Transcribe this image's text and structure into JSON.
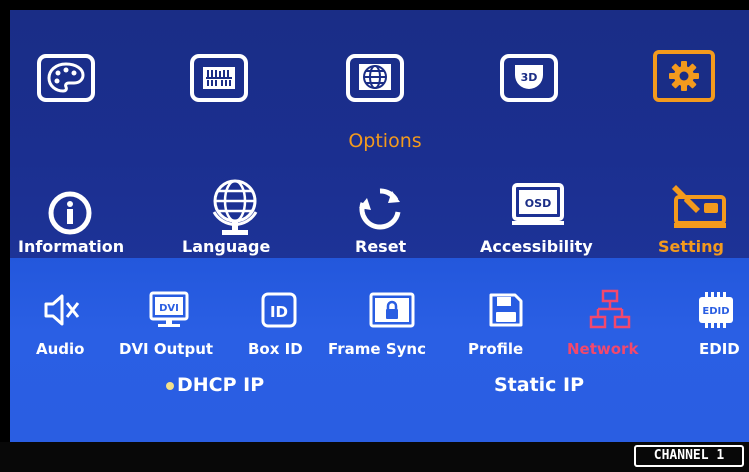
{
  "top_menu": {
    "items": [
      {
        "icon": "palette-icon",
        "selected": false
      },
      {
        "icon": "sliders-icon",
        "selected": false
      },
      {
        "icon": "globe-icon",
        "selected": false
      },
      {
        "icon": "3d-icon",
        "selected": false
      },
      {
        "icon": "gear-icon",
        "selected": true
      }
    ],
    "selected_label": "Options",
    "accent_color": "#f39a1d"
  },
  "options_row": {
    "items": [
      {
        "label": "Information",
        "icon": "info-icon"
      },
      {
        "label": "Language",
        "icon": "globe-grid-icon"
      },
      {
        "label": "Reset",
        "icon": "reset-icon"
      },
      {
        "label": "Accessibility",
        "icon": "osd-icon"
      },
      {
        "label": "Setting",
        "icon": "wrench-icon",
        "selected": true
      }
    ]
  },
  "setting_row": {
    "items": [
      {
        "label": "Audio",
        "icon": "speaker-mute-icon"
      },
      {
        "label": "DVI Output",
        "icon": "dvi-monitor-icon"
      },
      {
        "label": "Box ID",
        "icon": "id-icon"
      },
      {
        "label": "Frame Sync",
        "icon": "lock-frame-icon"
      },
      {
        "label": "Profile",
        "icon": "floppy-icon"
      },
      {
        "label": "Network",
        "icon": "network-icon",
        "selected": true
      },
      {
        "label": "EDID",
        "icon": "edid-chip-icon"
      }
    ],
    "selected_color": "#f2486d"
  },
  "network": {
    "dhcp_label": "DHCP IP",
    "static_label": "Static IP",
    "selected": "DHCP IP"
  },
  "status": {
    "channel_label": "CHANNEL 1"
  }
}
